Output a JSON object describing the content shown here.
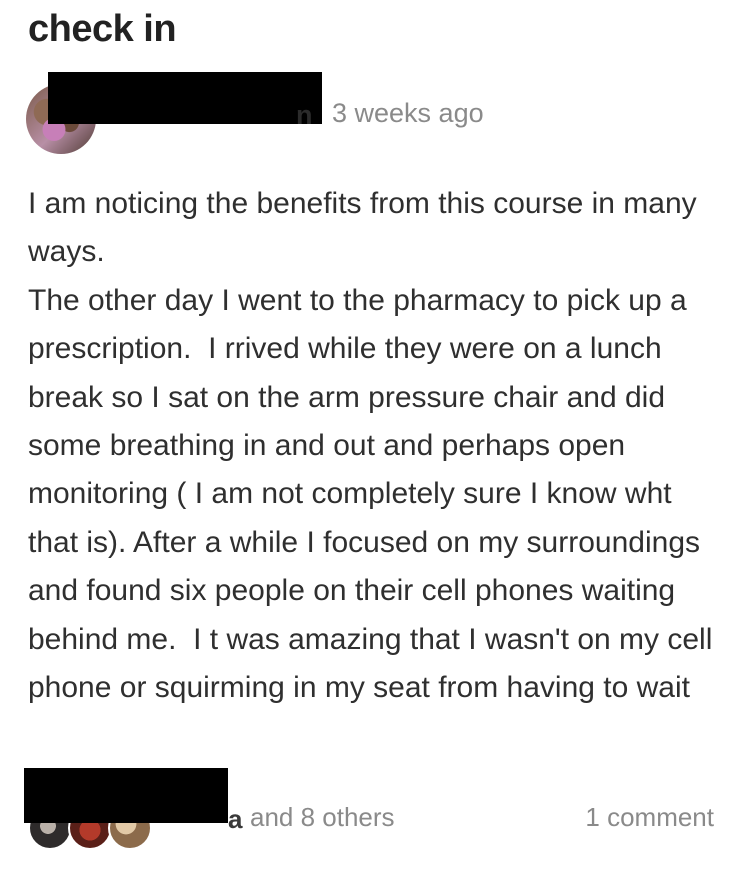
{
  "post": {
    "title": "check in",
    "author": {
      "name_visible_fragment": "n",
      "timestamp": "3 weeks ago"
    },
    "body_paragraphs": [
      "I am noticing the benefits from this course in many ways.",
      "The other day I went to the pharmacy to pick up a prescription.  I rrived while they were on a lunch break so I sat on the arm pressure chair and did some breathing in and out and perhaps open monitoring ( I am not completely sure I know wht that is). After a while I focused on my surroundings and found six people on their cell phones waiting behind me.  I t was amazing that I wasn't on my cell phone or squirming in my seat from having to wait"
    ]
  },
  "footer": {
    "likers_visible_fragment": "a",
    "likes_text": "and 8 others",
    "comments_text": "1 comment"
  },
  "colors": {
    "text": "#2f2f2f",
    "muted": "#8a8a8a",
    "redaction": "#000000"
  }
}
